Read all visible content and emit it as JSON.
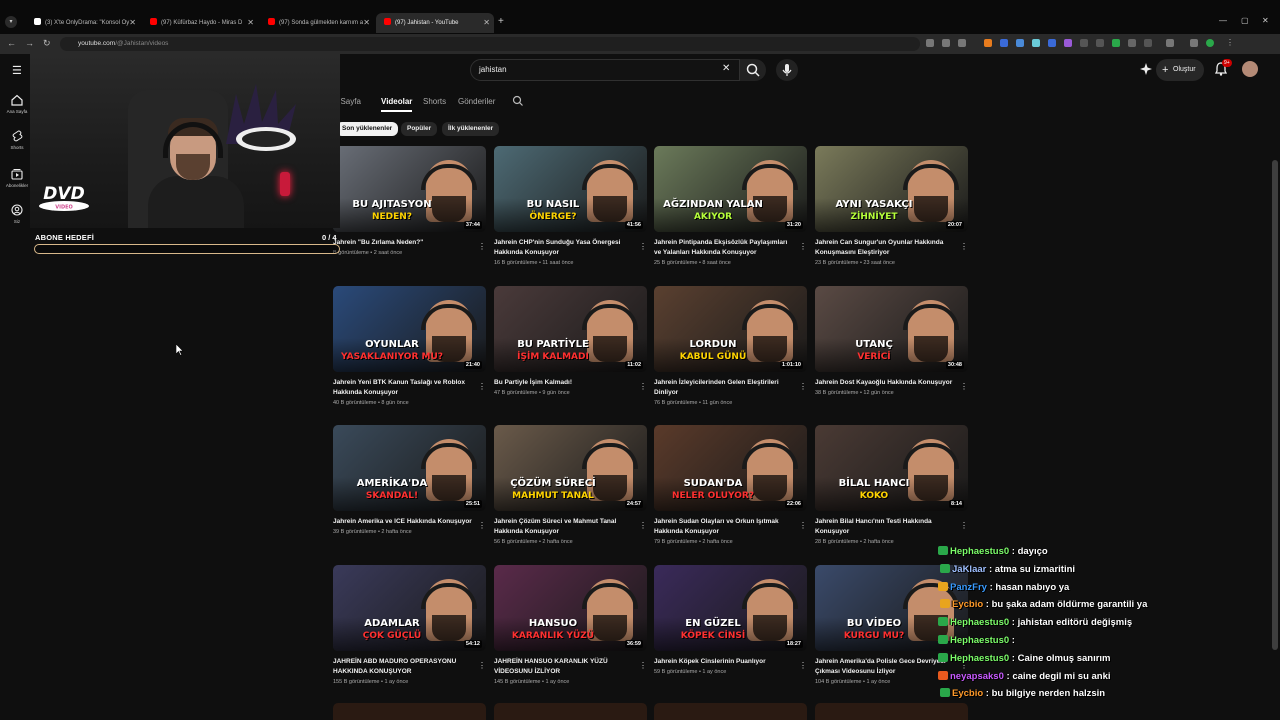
{
  "browser": {
    "tabs": [
      {
        "title": "(3) X'te OnlyDrama: \"Konsol Oy",
        "favicon_color": "#ffffff"
      },
      {
        "title": "(97) Küfürbaz Haydo - Miras D",
        "favicon_color": "#ff0000"
      },
      {
        "title": "(97) Sonda gülmekten karnım a",
        "favicon_color": "#ff0000"
      },
      {
        "title": "(97) Jahistan - YouTube",
        "favicon_color": "#ff0000"
      }
    ],
    "url_host": "youtube.com",
    "url_path": "/@Jahistan/videos"
  },
  "youtube": {
    "search_query": "jahistan",
    "create_label": "Oluştur",
    "notification_count": "9+",
    "guide": [
      {
        "label": "Ana Sayfa",
        "icon": "home-icon"
      },
      {
        "label": "Shorts",
        "icon": "shorts-icon"
      },
      {
        "label": "Abonelikler",
        "icon": "subscriptions-icon"
      },
      {
        "label": "Siz",
        "icon": "you-icon"
      }
    ],
    "channel_tabs": [
      {
        "label": "Ana Sayfa",
        "active": false
      },
      {
        "label": "Videolar",
        "active": true
      },
      {
        "label": "Shorts",
        "active": false
      },
      {
        "label": "Gönderiler",
        "active": false
      }
    ],
    "chips": [
      {
        "label": "Son yüklenenler",
        "active": true
      },
      {
        "label": "Popüler",
        "active": false
      },
      {
        "label": "İlk yüklenenler",
        "active": false
      }
    ],
    "videos": [
      {
        "title": "Jahrein \"Bu Zırlama Neden?\"",
        "views": "B görüntüleme",
        "age": "2 saat önce",
        "duration": "37:44",
        "thumb_text": "BU AJITASYON",
        "thumb_sub": "NEDEN?",
        "bg": "#6a6f78",
        "accent": "#ffd400"
      },
      {
        "title": "Jahrein CHP'nin Sunduğu Yasa Önergesi Hakkında Konuşuyor",
        "views": "16 B görüntüleme",
        "age": "11 saat önce",
        "duration": "41:56",
        "thumb_text": "BU NASIL",
        "thumb_sub": "ÖNERGE?",
        "bg": "#4d6a74",
        "accent": "#ffd400"
      },
      {
        "title": "Jahrein Pintipanda Ekşisözlük Paylaşımları ve Yalanları Hakkında Konuşuyor",
        "views": "25 B görüntüleme",
        "age": "8 saat önce",
        "duration": "31:20",
        "thumb_text": "AĞZINDAN YALAN",
        "thumb_sub": "AKIYOR",
        "bg": "#6b7a5a",
        "accent": "#b6ff3a"
      },
      {
        "title": "Jahrein Can Sungur'un Oyunlar Hakkında Konuşmasını Eleştiriyor",
        "views": "23 B görüntüleme",
        "age": "23 saat önce",
        "duration": "20:07",
        "thumb_text": "AYNI YASAKÇI",
        "thumb_sub": "ZİHNİYET",
        "bg": "#7a7a5a",
        "accent": "#b6ff3a"
      },
      {
        "title": "Jahrein Yeni BTK Kanun Taslağı ve Roblox Hakkında Konuşuyor",
        "views": "40 B görüntüleme",
        "age": "8 gün önce",
        "duration": "21:40",
        "thumb_text": "OYUNLAR",
        "thumb_sub": "YASAKLANIYOR MU?",
        "bg": "#2a4a7a",
        "accent": "#ff3030"
      },
      {
        "title": "Bu Partiyle İşim Kalmadı!",
        "views": "47 B görüntüleme",
        "age": "9 gün önce",
        "duration": "11:02",
        "thumb_text": "BU PARTİYLE",
        "thumb_sub": "İŞİM KALMADI",
        "bg": "#4a3a3a",
        "accent": "#ff3030"
      },
      {
        "title": "Jahrein İzleyicilerinden Gelen Eleştirileri Dinliyor",
        "views": "76 B görüntüleme",
        "age": "11 gün önce",
        "duration": "1:01:10",
        "thumb_text": "LORDUN",
        "thumb_sub": "KABUL GÜNÜ",
        "bg": "#5a4030",
        "accent": "#ffd400"
      },
      {
        "title": "Jahrein Dost Kayaoğlu Hakkında Konuşuyor",
        "views": "38 B görüntüleme",
        "age": "12 gün önce",
        "duration": "30:48",
        "thumb_text": "UTANÇ",
        "thumb_sub": "VERİCİ",
        "bg": "#5a4a44",
        "accent": "#ff3030"
      },
      {
        "title": "Jahrein Amerika ve ICE Hakkında Konuşuyor",
        "views": "39 B görüntüleme",
        "age": "2 hafta önce",
        "duration": "25:51",
        "thumb_text": "AMERİKA'DA",
        "thumb_sub": "SKANDAL!",
        "bg": "#3a4a5a",
        "accent": "#ff3030"
      },
      {
        "title": "Jahrein Çözüm Süreci ve Mahmut Tanal Hakkında Konuşuyor",
        "views": "56 B görüntüleme",
        "age": "2 hafta önce",
        "duration": "24:57",
        "thumb_text": "ÇÖZÜM SÜRECİ",
        "thumb_sub": "MAHMUT TANAL",
        "bg": "#6a5a4a",
        "accent": "#ffd400"
      },
      {
        "title": "Jahrein Sudan Olayları ve Orkun Işıtmak Hakkında Konuşuyor",
        "views": "79 B görüntüleme",
        "age": "2 hafta önce",
        "duration": "22:06",
        "thumb_text": "SUDAN'DA",
        "thumb_sub": "NELER OLUYOR?",
        "bg": "#5a3a2a",
        "accent": "#ff3030"
      },
      {
        "title": "Jahrein Bilal Hancı'nın Testi Hakkında Konuşuyor",
        "views": "28 B görüntüleme",
        "age": "2 hafta önce",
        "duration": "8:14",
        "thumb_text": "BİLAL HANCI",
        "thumb_sub": "KOKO",
        "bg": "#4a3a34",
        "accent": "#ffd400"
      },
      {
        "title": "JAHREİN ABD MADURO OPERASYONU HAKKINDA KONUŞUYOR",
        "views": "155 B görüntüleme",
        "age": "1 ay önce",
        "duration": "54:12",
        "thumb_text": "ADAMLAR",
        "thumb_sub": "ÇOK GÜÇLÜ",
        "bg": "#3a3a5a",
        "accent": "#ff3030"
      },
      {
        "title": "JAHREİN HANSUO KARANLIK YÜZÜ VİDEOSUNU İZLİYOR",
        "views": "145 B görüntüleme",
        "age": "1 ay önce",
        "duration": "36:59",
        "thumb_text": "HANSUO",
        "thumb_sub": "KARANLIK YÜZÜ",
        "bg": "#5a2a4a",
        "accent": "#ff3030"
      },
      {
        "title": "Jahrein Köpek Cinslerinin Puanlıyor",
        "views": "59 B görüntüleme",
        "age": "1 ay önce",
        "duration": "18:27",
        "thumb_text": "EN GÜZEL",
        "thumb_sub": "KÖPEK CİNSİ",
        "bg": "#3a2a5a",
        "accent": "#ff3030"
      },
      {
        "title": "Jahrein Amerika'da Polisle Gece Devriyesi Çıkması Videosunu İzliyor",
        "views": "104 B görüntüleme",
        "age": "1 ay önce",
        "duration": "",
        "thumb_text": "BU VİDEO",
        "thumb_sub": "KURGU MU?",
        "bg": "#3a4a6a",
        "accent": "#ff3030"
      }
    ]
  },
  "stream_overlay": {
    "goal_label": "ABONE HEDEFİ",
    "goal_count": "0  / 4",
    "goal_fraction": 0.0,
    "dvd_text": "DVD",
    "dvd_sub": "VIDEO"
  },
  "chat": [
    {
      "user": "Hephaestus0",
      "msg": " : dayıço",
      "color": "#7CFC6A"
    },
    {
      "user": "JaKlaar",
      "msg": " : atma su izmaritini",
      "color": "#9fbfff"
    },
    {
      "user": "PanzFry",
      "msg": " : hasan nabıyo ya",
      "color": "#3a9cff"
    },
    {
      "user": "Eycbio",
      "msg": " : bu şaka adam öldürme garantili ya",
      "color": "#ff9a2a"
    },
    {
      "user": "Hephaestus0",
      "msg": " : jahistan editörü değişmiş",
      "color": "#7CFC6A"
    },
    {
      "user": "Hephaestus0",
      "msg": " : ",
      "color": "#7CFC6A"
    },
    {
      "user": "Hephaestus0",
      "msg": " : Caine olmuş sanırım",
      "color": "#7CFC6A"
    },
    {
      "user": "neyapsaks0",
      "msg": " : caine degil mi su anki",
      "color": "#c85aff"
    },
    {
      "user": "Eycbio",
      "msg": " : bu bilgiye nerden halzsin",
      "color": "#ff9a2a"
    }
  ]
}
